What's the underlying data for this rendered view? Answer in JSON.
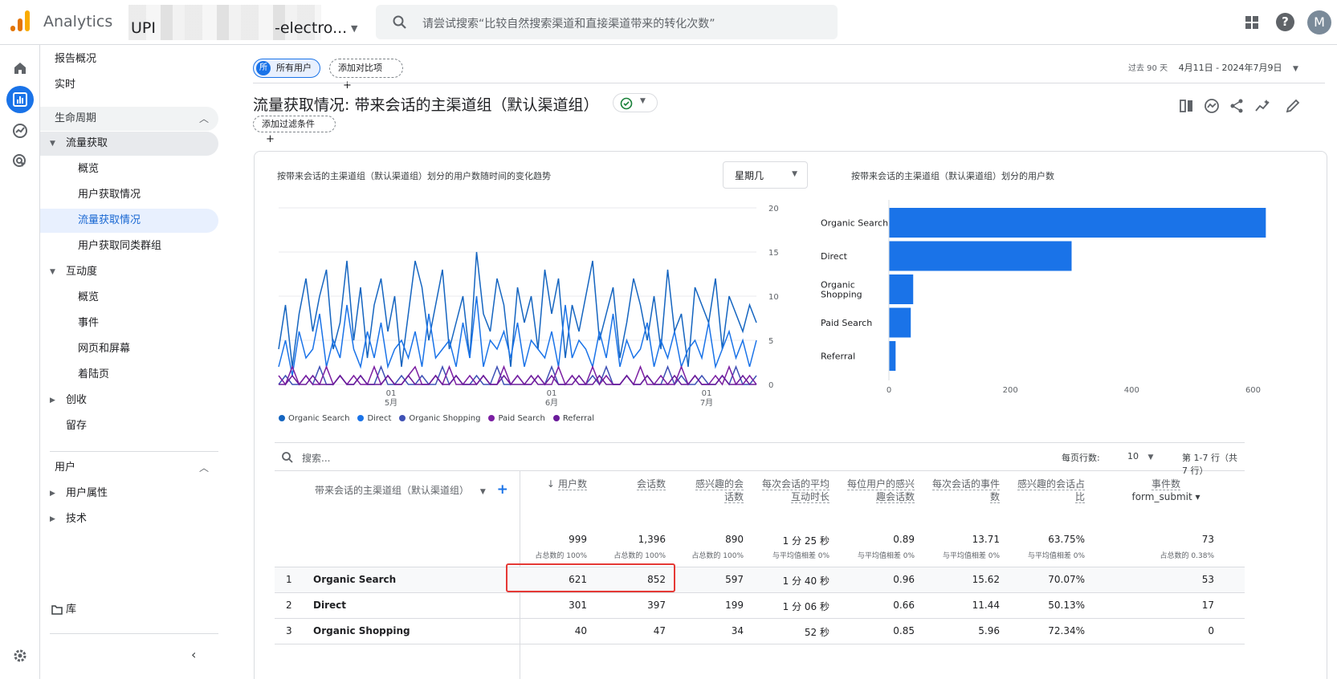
{
  "header": {
    "app_title": "Analytics",
    "property_prefix": "UPI",
    "property_suffix": "-electro...",
    "search_placeholder": "请尝试搜索“比较自然搜索渠道和直接渠道带来的转化次数”",
    "avatar_letter": "M"
  },
  "nav": {
    "items": [
      {
        "label": "报告概况"
      },
      {
        "label": "实时"
      },
      {
        "label": "生命周期"
      },
      {
        "label": "流量获取"
      },
      {
        "label": "概览"
      },
      {
        "label": "用户获取情况"
      },
      {
        "label": "流量获取情况"
      },
      {
        "label": "用户获取同类群组"
      },
      {
        "label": "互动度"
      },
      {
        "label": "概览"
      },
      {
        "label": "事件"
      },
      {
        "label": "网页和屏幕"
      },
      {
        "label": "着陆页"
      },
      {
        "label": "创收"
      },
      {
        "label": "留存"
      },
      {
        "label": "用户"
      },
      {
        "label": "用户属性"
      },
      {
        "label": "技术"
      },
      {
        "label": "库"
      }
    ]
  },
  "toolbar": {
    "segment_badge": "所",
    "segment_label": "所有用户",
    "compare_label": "添加对比项",
    "date_label": "过去 90 天",
    "date_range": "4月11日 - 2024年7月9日",
    "page_title": "流量获取情况: 带来会话的主渠道组（默认渠道组）",
    "filter_label": "添加过滤条件"
  },
  "line_chart": {
    "title": "按带来会话的主渠道组（默认渠道组）划分的用户数随时间的变化趋势",
    "dropdown": "星期几",
    "y_ticks": [
      "20",
      "15",
      "10",
      "5",
      "0"
    ],
    "x_ticks": [
      {
        "day": "01",
        "month": "5月"
      },
      {
        "day": "01",
        "month": "6月"
      },
      {
        "day": "01",
        "month": "7月"
      }
    ],
    "legend": [
      {
        "name": "Organic Search",
        "color": "#1565c0"
      },
      {
        "name": "Direct",
        "color": "#1a73e8"
      },
      {
        "name": "Organic Shopping",
        "color": "#3f51b5"
      },
      {
        "name": "Paid Search",
        "color": "#7b1fa2"
      },
      {
        "name": "Referral",
        "color": "#6a1b9a"
      }
    ]
  },
  "chart_data": [
    {
      "type": "line",
      "title": "按带来会话的主渠道组（默认渠道组）划分的用户数随时间的变化趋势",
      "ylim": [
        0,
        20
      ],
      "series": [
        {
          "name": "Organic Search",
          "values": [
            4,
            9,
            2,
            8,
            12,
            6,
            10,
            13,
            4,
            7,
            14,
            5,
            11,
            3,
            9,
            12,
            6,
            10,
            2,
            8,
            14,
            11,
            5,
            9,
            13,
            4,
            7,
            10,
            3,
            15,
            8,
            6,
            12,
            9,
            2,
            11,
            7,
            10,
            4,
            13,
            8,
            12,
            3,
            9,
            6,
            10,
            14,
            5,
            8,
            11,
            3,
            7,
            12,
            9,
            5,
            10,
            4,
            13,
            6,
            8,
            2,
            11,
            9,
            7,
            12,
            4,
            10,
            8,
            6,
            9,
            7
          ]
        },
        {
          "name": "Direct",
          "values": [
            2,
            5,
            1,
            6,
            3,
            4,
            8,
            2,
            5,
            3,
            9,
            4,
            2,
            6,
            3,
            7,
            2,
            4,
            5,
            3,
            6,
            2,
            8,
            3,
            4,
            5,
            2,
            7,
            3,
            10,
            2,
            5,
            4,
            6,
            3,
            7,
            2,
            5,
            4,
            3,
            6,
            2,
            9,
            3,
            5,
            4,
            2,
            6,
            3,
            8,
            2,
            5,
            3,
            4,
            7,
            2,
            5,
            3,
            6,
            2,
            4,
            5,
            3,
            7,
            2,
            4,
            6,
            3,
            5,
            2,
            5
          ]
        },
        {
          "name": "Organic Shopping",
          "values": [
            0,
            1,
            0,
            0,
            1,
            0,
            2,
            0,
            0,
            1,
            0,
            0,
            1,
            0,
            0,
            2,
            0,
            0,
            1,
            0,
            0,
            1,
            0,
            0,
            2,
            0,
            1,
            0,
            0,
            1,
            0,
            0,
            2,
            0,
            0,
            1,
            0,
            0,
            1,
            0,
            2,
            0,
            0,
            1,
            0,
            0,
            1,
            0,
            2,
            0,
            0,
            1,
            0,
            0,
            1,
            0,
            0,
            2,
            0,
            1,
            0,
            0,
            1,
            0,
            0,
            1,
            0,
            2,
            0,
            0,
            1
          ]
        },
        {
          "name": "Paid Search",
          "values": [
            1,
            0,
            2,
            0,
            1,
            0,
            0,
            2,
            0,
            1,
            0,
            1,
            0,
            0,
            2,
            0,
            1,
            0,
            0,
            1,
            2,
            0,
            0,
            1,
            0,
            2,
            0,
            0,
            1,
            0,
            1,
            0,
            0,
            2,
            0,
            1,
            0,
            0,
            1,
            0,
            0,
            2,
            0,
            1,
            0,
            0,
            2,
            0,
            1,
            0,
            0,
            1,
            0,
            2,
            0,
            0,
            1,
            0,
            0,
            2,
            0,
            1,
            0,
            0,
            1,
            0,
            2,
            0,
            0,
            1,
            0
          ]
        },
        {
          "name": "Referral",
          "values": [
            0,
            0,
            1,
            0,
            0,
            1,
            0,
            0,
            0,
            1,
            0,
            0,
            1,
            0,
            0,
            0,
            1,
            0,
            0,
            1,
            0,
            0,
            0,
            1,
            0,
            0,
            1,
            0,
            0,
            0,
            1,
            0,
            0,
            1,
            0,
            0,
            0,
            1,
            0,
            0,
            1,
            0,
            0,
            0,
            1,
            0,
            0,
            1,
            0,
            0,
            0,
            1,
            0,
            0,
            1,
            0,
            0,
            0,
            1,
            0,
            0,
            1,
            0,
            0,
            0,
            1,
            0,
            0,
            1,
            0,
            0
          ]
        }
      ]
    },
    {
      "type": "bar",
      "title": "按带来会话的主渠道组（默认渠道组）划分的用户数",
      "categories": [
        "Organic Search",
        "Direct",
        "Organic Shopping",
        "Paid Search",
        "Referral"
      ],
      "values": [
        621,
        301,
        40,
        36,
        11
      ],
      "xlim": [
        0,
        700
      ],
      "x_ticks": [
        "0",
        "200",
        "400",
        "600"
      ]
    }
  ],
  "table": {
    "search_placeholder": "搜索...",
    "rows_per_page_label": "每页行数:",
    "rows_per_page": "10",
    "page_range": "第 1-7 行（共 7 行）",
    "dimension_header": "带来会话的主渠道组（默认渠道组）",
    "columns": [
      {
        "label": "用户数",
        "total": "999",
        "sub": "占总数的 100%"
      },
      {
        "label": "会话数",
        "total": "1,396",
        "sub": "占总数的 100%"
      },
      {
        "label": "感兴趣的会话数",
        "total": "890",
        "sub": "占总数的 100%"
      },
      {
        "label": "每次会话的平均互动时长",
        "total": "1 分 25 秒",
        "sub": "与平均值相差 0%"
      },
      {
        "label": "每位用户的感兴趣会话数",
        "total": "0.89",
        "sub": "与平均值相差 0%"
      },
      {
        "label": "每次会话的事件数",
        "total": "13.71",
        "sub": "与平均值相差 0%"
      },
      {
        "label": "感兴趣的会话占比",
        "total": "63.75%",
        "sub": "与平均值相差 0%"
      },
      {
        "label": "事件数",
        "label2": "form_submit",
        "total": "73",
        "sub": "占总数的 0.38%"
      }
    ],
    "rows": [
      {
        "idx": "1",
        "dim": "Organic Search",
        "vals": [
          "621",
          "852",
          "597",
          "1 分 40 秒",
          "0.96",
          "15.62",
          "70.07%",
          "53"
        ]
      },
      {
        "idx": "2",
        "dim": "Direct",
        "vals": [
          "301",
          "397",
          "199",
          "1 分 06 秒",
          "0.66",
          "11.44",
          "50.13%",
          "17"
        ]
      },
      {
        "idx": "3",
        "dim": "Organic Shopping",
        "vals": [
          "40",
          "47",
          "34",
          "52 秒",
          "0.85",
          "5.96",
          "72.34%",
          "0"
        ]
      }
    ]
  }
}
